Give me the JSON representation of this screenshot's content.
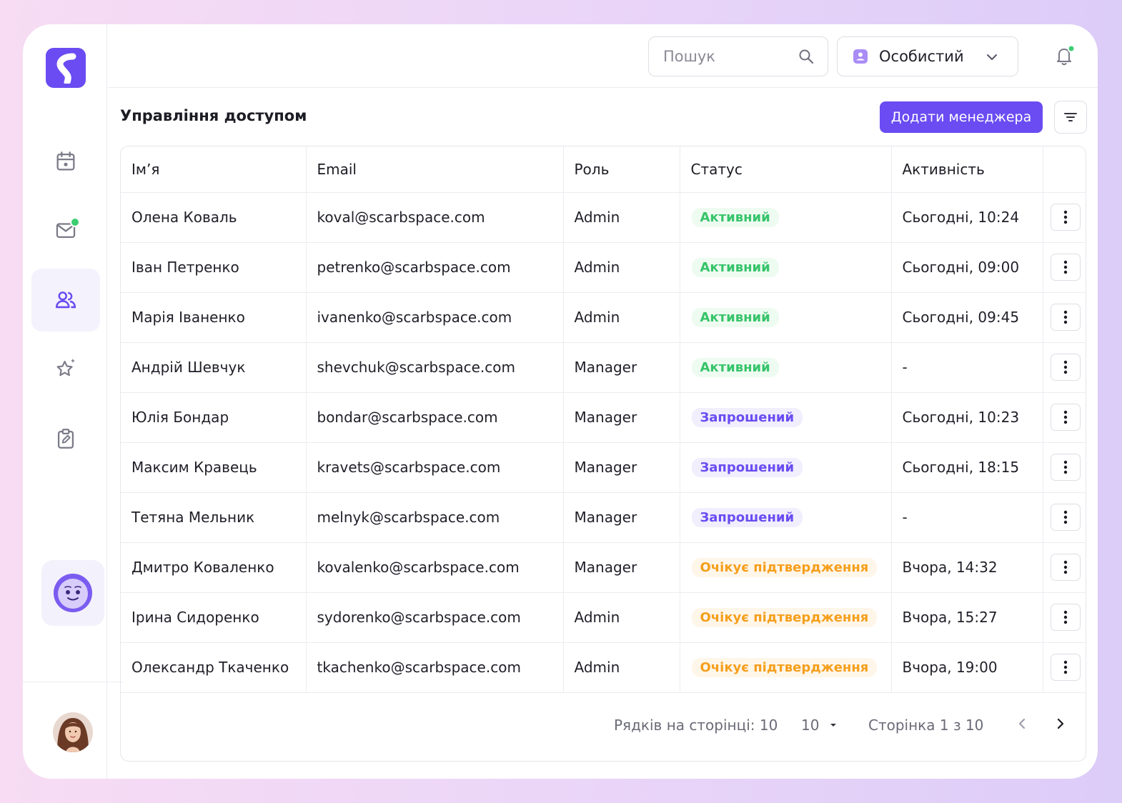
{
  "header": {
    "search_placeholder": "Пошук",
    "account_label": "Особистий"
  },
  "page": {
    "title": "Управління доступом",
    "add_button": "Додати менеджера"
  },
  "table": {
    "columns": [
      "Ім’я",
      "Email",
      "Роль",
      "Статус",
      "Активність"
    ],
    "rows": [
      {
        "name": "Олена Коваль",
        "email": "koval@scarbspace.com",
        "role": "Admin",
        "status": "Активний",
        "status_type": "active",
        "activity": "Сьогодні, 10:24"
      },
      {
        "name": "Іван Петренко",
        "email": "petrenko@scarbspace.com",
        "role": "Admin",
        "status": "Активний",
        "status_type": "active",
        "activity": "Сьогодні, 09:00"
      },
      {
        "name": "Марія Іваненко",
        "email": "ivanenko@scarbspace.com",
        "role": "Admin",
        "status": "Активний",
        "status_type": "active",
        "activity": "Сьогодні, 09:45"
      },
      {
        "name": "Андрій Шевчук",
        "email": "shevchuk@scarbspace.com",
        "role": "Manager",
        "status": "Активний",
        "status_type": "active",
        "activity": "-"
      },
      {
        "name": "Юлія Бондар",
        "email": "bondar@scarbspace.com",
        "role": "Manager",
        "status": "Запрошений",
        "status_type": "invited",
        "activity": "Сьогодні, 10:23"
      },
      {
        "name": "Максим Кравець",
        "email": "kravets@scarbspace.com",
        "role": "Manager",
        "status": "Запрошений",
        "status_type": "invited",
        "activity": "Сьогодні, 18:15"
      },
      {
        "name": "Тетяна Мельник",
        "email": "melnyk@scarbspace.com",
        "role": "Manager",
        "status": "Запрошений",
        "status_type": "invited",
        "activity": "-"
      },
      {
        "name": "Дмитро Коваленко",
        "email": "kovalenko@scarbspace.com",
        "role": "Manager",
        "status": "Очікує підтвердження",
        "status_type": "pending",
        "activity": "Вчора, 14:32"
      },
      {
        "name": "Ірина Сидоренко",
        "email": "sydorenko@scarbspace.com",
        "role": "Admin",
        "status": "Очікує підтвердження",
        "status_type": "pending",
        "activity": "Вчора, 15:27"
      },
      {
        "name": "Олександр Ткаченко",
        "email": "tkachenko@scarbspace.com",
        "role": "Admin",
        "status": "Очікує підтвердження",
        "status_type": "pending",
        "activity": "Вчора, 19:00"
      }
    ]
  },
  "pagination": {
    "rows_per_page_label": "Рядків на сторінці: 10",
    "rows_select_value": "10",
    "page_label": "Сторінка 1 з 10"
  },
  "sidebar": {
    "items": [
      {
        "icon": "calendar-icon"
      },
      {
        "icon": "mail-icon",
        "badge": true
      },
      {
        "icon": "users-icon",
        "active": true
      },
      {
        "icon": "star-icon"
      },
      {
        "icon": "clipboard-edit-icon"
      }
    ]
  },
  "colors": {
    "accent": "#6a4cf2",
    "active_status": "#36c46a",
    "invited_status": "#6a4cf2",
    "pending_status": "#f59f1c",
    "notification_dot": "#3ccd72"
  }
}
